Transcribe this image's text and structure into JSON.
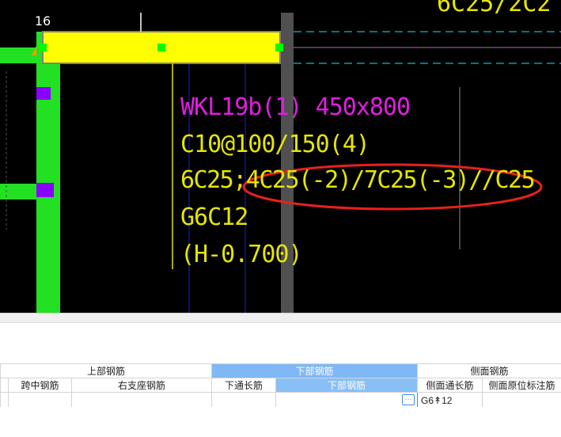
{
  "cad": {
    "axis_label": "16",
    "beam_name": "WKL19b(1) 450x800",
    "stirrup": "C10@100/150(4)",
    "bottom_rebar": "6C25;4C25(-2)/7C25(-3)//C25",
    "side_rebar": "G6C12",
    "elevation": "(H-0.700)",
    "top_text": "6C25/2C2",
    "colors": {
      "background": "#000000",
      "column_green": "#22e022",
      "beam_yellow": "#ffff00",
      "text_magenta": "#e01ee0",
      "text_yellow": "#e6e600",
      "grip_green": "#00ff00",
      "grip_purple": "#8a00ff",
      "highlight_ellipse": "#e8201e",
      "grid_blue": "#1e1ed8",
      "dash_cyan": "#00bcd4"
    }
  },
  "table": {
    "group_headers": {
      "top_rebar": "上部钢筋",
      "bottom_rebar": "下部钢筋",
      "side_rebar": "侧面钢筋"
    },
    "columns": {
      "mid_span": "跨中钢筋",
      "right_support": "右支座钢筋",
      "bottom_through": "下通长筋",
      "bottom_rebar": "下部钢筋",
      "side_through": "侧面通长筋",
      "side_original": "侧面原位标注筋"
    },
    "row": {
      "side_through_value": "G6↟12"
    },
    "ellipsis": "···"
  }
}
